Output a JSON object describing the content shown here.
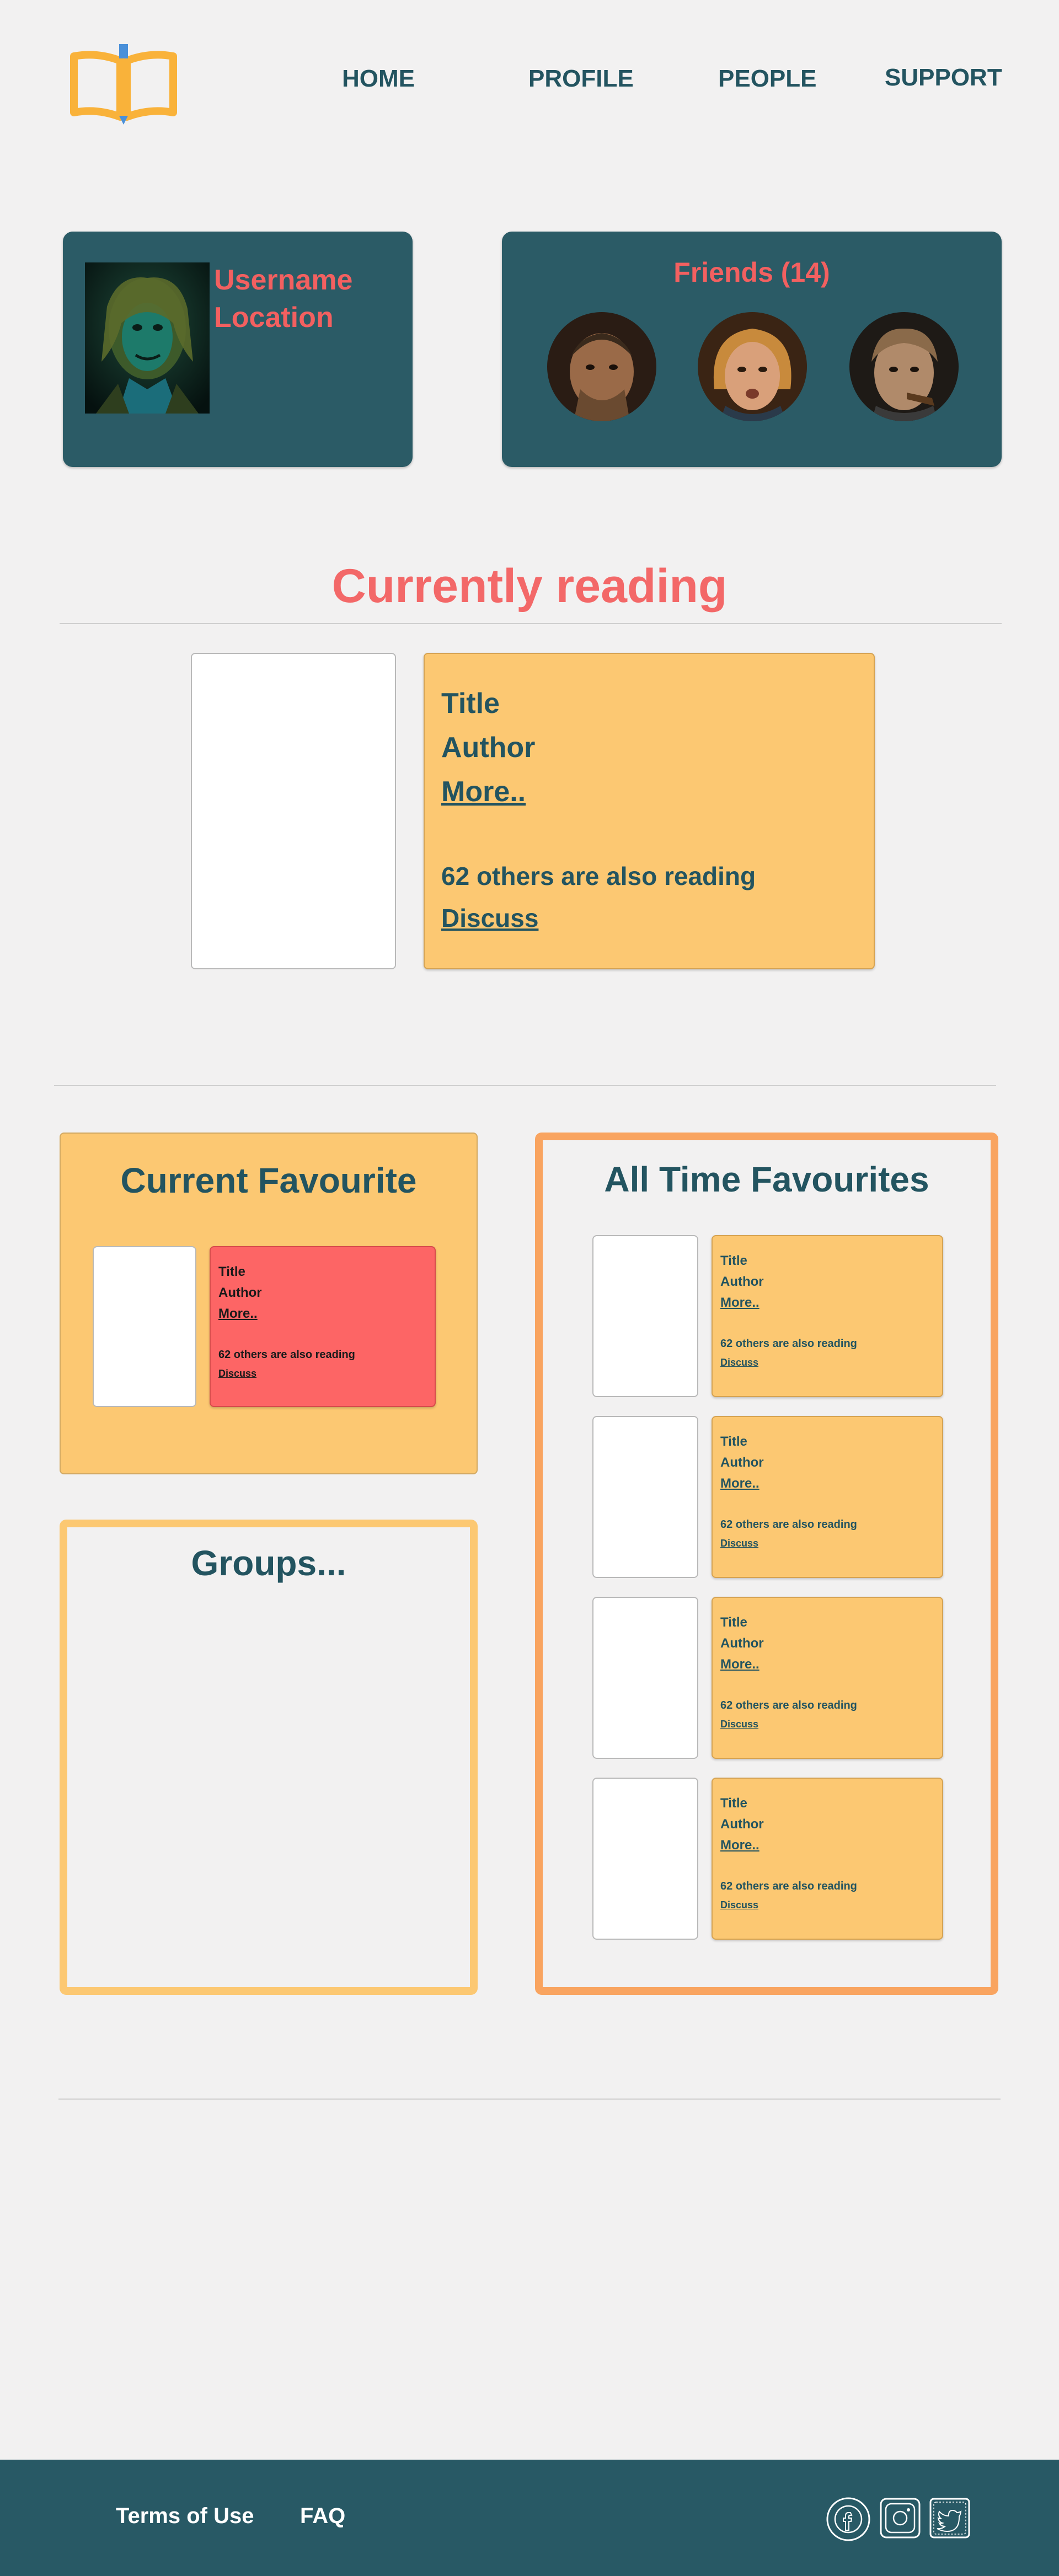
{
  "nav": {
    "items": [
      {
        "label": "HOME"
      },
      {
        "label": "PROFILE"
      },
      {
        "label": "PEOPLE"
      },
      {
        "label": "SUPPORT"
      }
    ]
  },
  "profile": {
    "username": "Username",
    "location": "Location"
  },
  "friends": {
    "title": "Friends (14)"
  },
  "currently_reading": {
    "heading": "Currently reading",
    "book": {
      "title": "Title",
      "author": "Author",
      "more": "More..",
      "reading_count": "62 others are also reading",
      "discuss": "Discuss"
    }
  },
  "current_favourite": {
    "heading": "Current Favourite",
    "book": {
      "title": "Title",
      "author": "Author",
      "more": "More..",
      "reading_count": "62 others are also reading",
      "discuss": "Discuss"
    }
  },
  "all_time": {
    "heading": "All Time Favourites",
    "books": [
      {
        "title": "Title",
        "author": "Author",
        "more": "More..",
        "reading_count": "62 others are also reading",
        "discuss": "Discuss"
      },
      {
        "title": "Title",
        "author": "Author",
        "more": "More..",
        "reading_count": "62 others are also reading",
        "discuss": "Discuss"
      },
      {
        "title": "Title",
        "author": "Author",
        "more": "More..",
        "reading_count": "62 others are also reading",
        "discuss": "Discuss"
      },
      {
        "title": "Title",
        "author": "Author",
        "more": "More..",
        "reading_count": "62 others are also reading",
        "discuss": "Discuss"
      }
    ]
  },
  "groups": {
    "heading": "Groups..."
  },
  "footer": {
    "terms": "Terms of Use",
    "faq": "FAQ",
    "social": [
      "facebook-icon",
      "instagram-icon",
      "twitter-icon"
    ]
  },
  "colors": {
    "teal": "#2b5b66",
    "orange": "#fcc872",
    "coral": "#f36868",
    "dark_orange": "#f9a460",
    "footer": "#285965"
  }
}
